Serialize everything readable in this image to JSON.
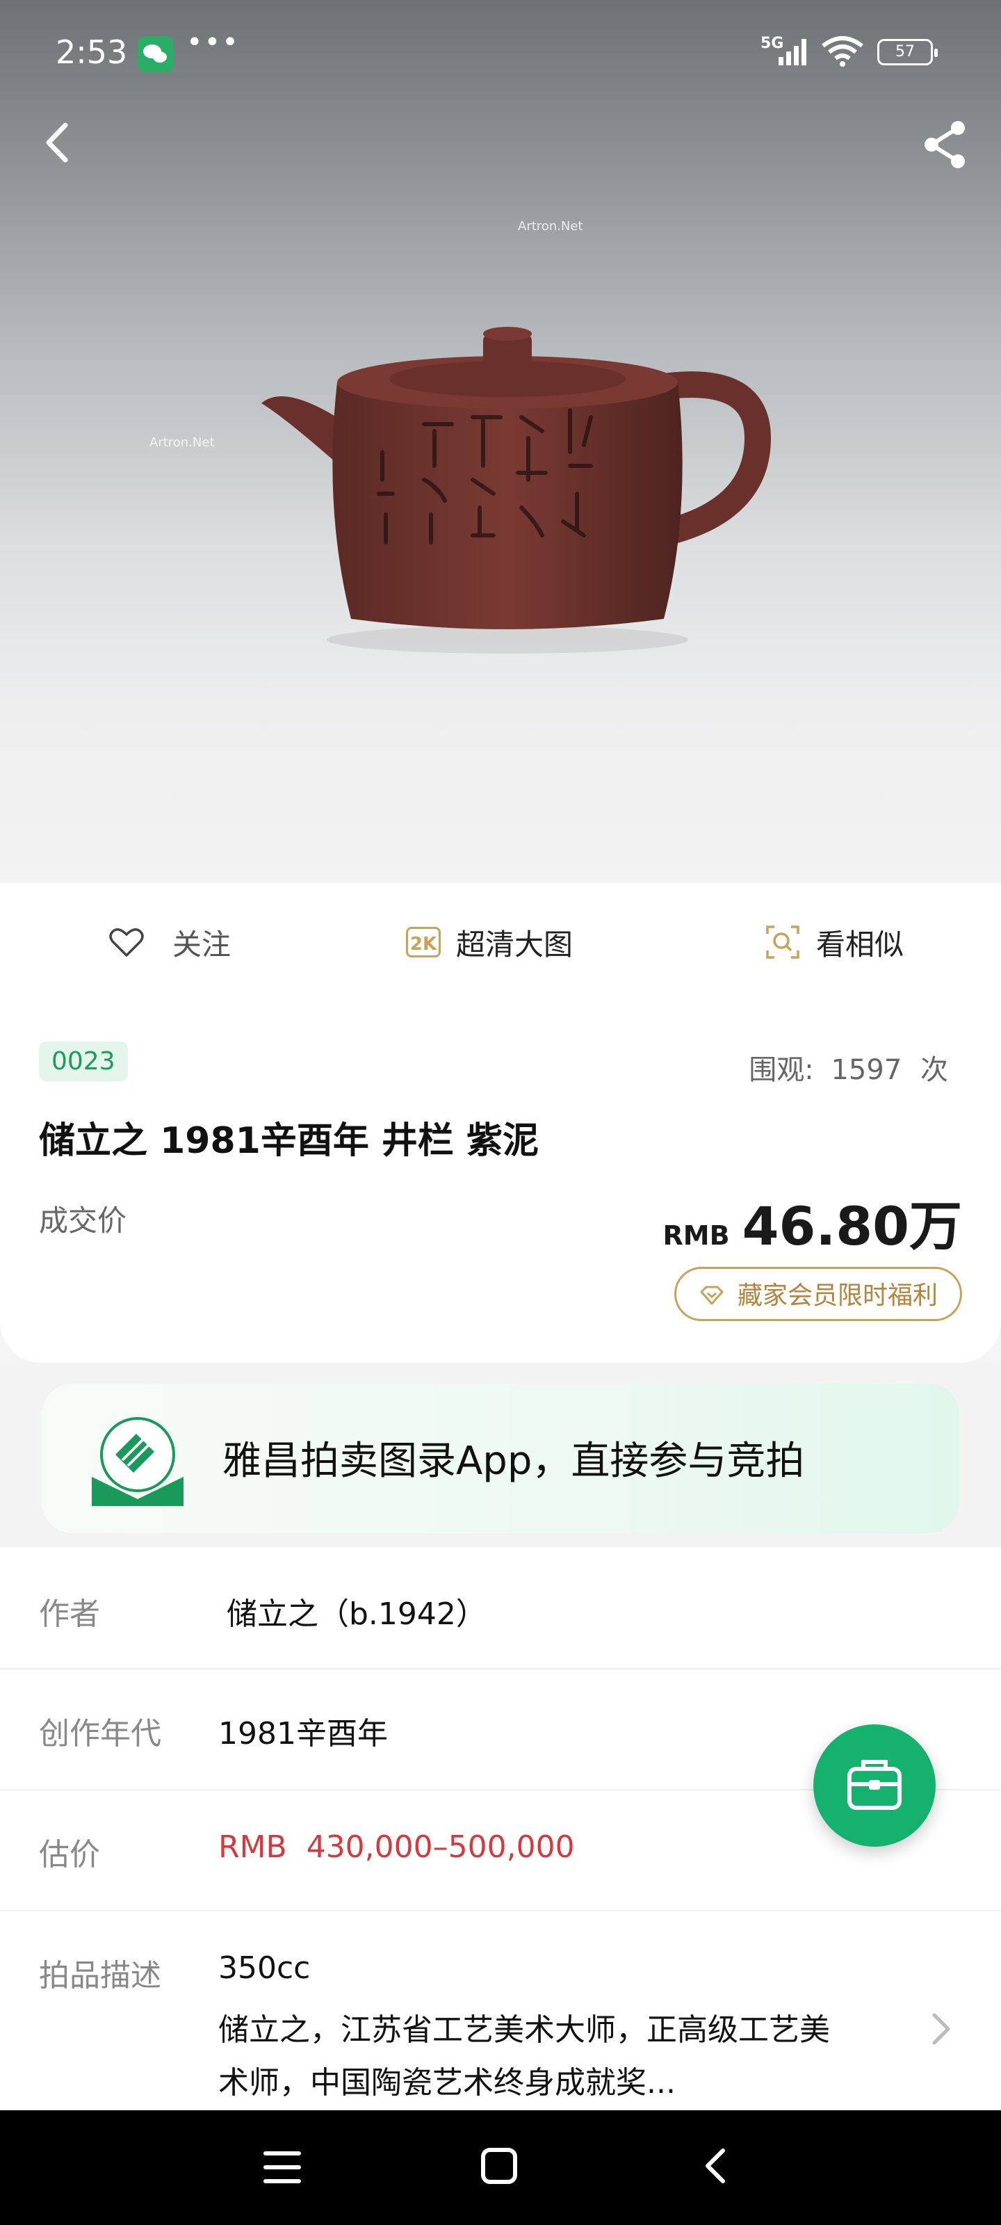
{
  "status_bar": {
    "time": "2:53",
    "dots": "•••",
    "network": "5G",
    "battery": "57"
  },
  "hero": {
    "watermark": "Artron.Net"
  },
  "actions": {
    "follow": "关注",
    "hd_badge": "2K",
    "hd": "超清大图",
    "similar": "看相似"
  },
  "info": {
    "lot_no": "0023",
    "views_label": "围观:",
    "views_count": "1597",
    "views_unit": "次",
    "title": "储立之 1981辛酉年 井栏 紫泥",
    "sold_label": "成交价",
    "currency": "RMB",
    "price": "46.80万",
    "vip_text": "藏家会员限时福利"
  },
  "banner": {
    "text": "雅昌拍卖图录App，直接参与竞拍"
  },
  "details": [
    {
      "key": "作者",
      "value": "储立之（b.1942）"
    },
    {
      "key": "创作年代",
      "value": "1981辛酉年"
    },
    {
      "key": "估价",
      "value": "RMB  430,000–500,000"
    },
    {
      "key": "拍品描述",
      "value": "350cc",
      "extra1": "储立之，江苏省工艺美术大师，正高级工艺美",
      "extra2": "术师，中国陶瓷艺术终身成就奖..."
    }
  ],
  "colors": {
    "accent_green": "#14b26e",
    "price_red": "#d6393d",
    "gold": "#b3853c"
  }
}
